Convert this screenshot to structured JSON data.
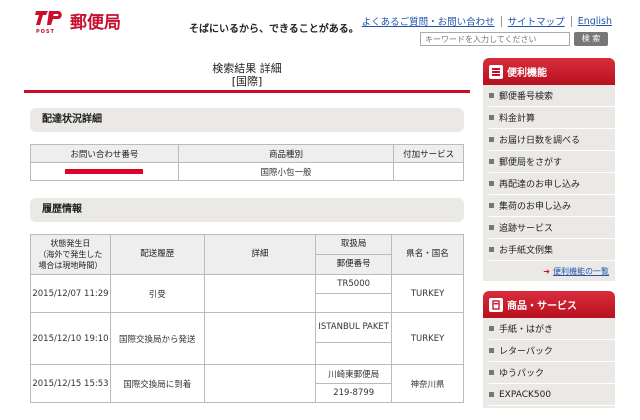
{
  "header": {
    "logo_post": "POST",
    "logo_name": "郵便局",
    "tagline": "そばにいるから、できることがある。",
    "links": [
      "よくあるご質問・お問い合わせ",
      "サイトマップ",
      "English"
    ],
    "search_placeholder": "キーワードを入力してください",
    "search_button": "検 索",
    "brand_color": "#c8102e"
  },
  "main": {
    "title_line1": "検索結果 詳細",
    "title_line2": "[国際]",
    "delivery_section": "配達状況詳細",
    "delivery_table": {
      "headers": [
        "お問い合わせ番号",
        "商品種別",
        "付加サービス"
      ],
      "row": {
        "tracking_number": "",
        "product": "国際小包一般",
        "service": ""
      }
    },
    "history_section": "履歴情報",
    "history_table": {
      "h_date": "状態発生日\n（海外で発生した\n場合は現地時間）",
      "h_history": "配送履歴",
      "h_detail": "詳細",
      "h_office": "取扱局",
      "h_postal": "郵便番号",
      "h_region": "県名・国名",
      "rows": [
        {
          "date": "2015/12/07 11:29",
          "history": "引受",
          "detail": "",
          "office": "TR5000",
          "postal": "",
          "region": "TURKEY"
        },
        {
          "date": "2015/12/10 19:10",
          "history": "国際交換局から発送",
          "detail": "",
          "office": "ISTANBUL PAKET",
          "postal": "",
          "region": "TURKEY"
        },
        {
          "date": "2015/12/15 15:53",
          "history": "国際交換局に到着",
          "detail": "",
          "office": "川崎東郵便局",
          "postal": "219-8799",
          "region": "神奈川県"
        }
      ]
    }
  },
  "sidebar": {
    "convenience_title": "便利機能",
    "convenience_items": [
      "郵便番号検索",
      "料金計算",
      "お届け日数を調べる",
      "郵便局をさがす",
      "再配達のお申し込み",
      "集荷のお申し込み",
      "追跡サービス",
      "お手紙文例集"
    ],
    "more_link": "便利機能の一覧",
    "products_title": "商品・サービス",
    "products_items": [
      "手紙・はがき",
      "レターパック",
      "ゆうパック",
      "EXPACK500"
    ]
  }
}
